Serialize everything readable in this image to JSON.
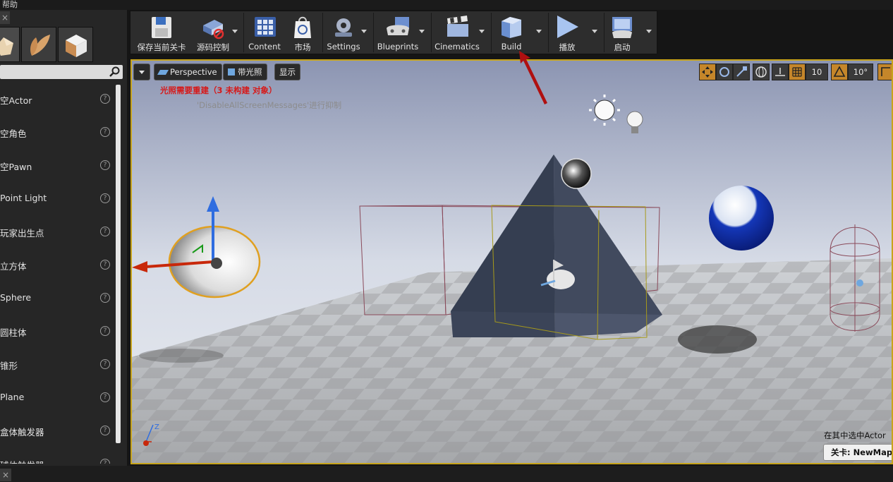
{
  "menu": {
    "help": "帮助"
  },
  "panel": {
    "close_glyph": "×",
    "search_placeholder": "",
    "items": [
      {
        "label": "空Actor"
      },
      {
        "label": "空角色"
      },
      {
        "label": "空Pawn"
      },
      {
        "label": "Point Light"
      },
      {
        "label": "玩家出生点"
      },
      {
        "label": "立方体"
      },
      {
        "label": "Sphere"
      },
      {
        "label": "圆柱体"
      },
      {
        "label": "锥形"
      },
      {
        "label": "Plane"
      },
      {
        "label": "盒体触发器"
      },
      {
        "label": "球体触发器"
      }
    ],
    "help_glyph": "?"
  },
  "toolbar": {
    "save": "保存当前关卡",
    "source_control": "源码控制",
    "content": "Content",
    "marketplace": "市场",
    "settings": "Settings",
    "blueprints": "Blueprints",
    "cinematics": "Cinematics",
    "build": "Build",
    "play": "播放",
    "launch": "启动"
  },
  "viewport": {
    "perspective": "Perspective",
    "lit": "带光照",
    "show": "显示",
    "grid_snap": "10",
    "rotation_snap": "10°",
    "lighting_warning": "光照需要重建（3 未构建 对象）",
    "suppress_msg": "'DisableAllScreenMessages'进行抑制",
    "selected_info": "在其中选中Actor",
    "level_prefix": "关卡: ",
    "level_name": "NewMap (永"
  },
  "colors": {
    "accent": "#c7a41b",
    "warning": "#d61a1a",
    "tool_active": "#c5862a"
  }
}
